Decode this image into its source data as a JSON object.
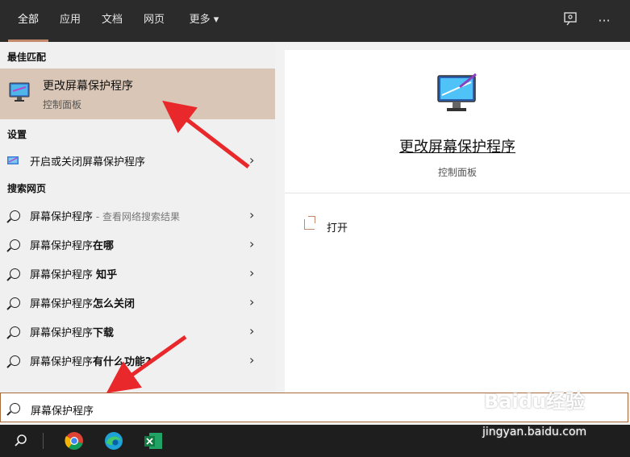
{
  "tabs": [
    "全部",
    "应用",
    "文档",
    "网页",
    "更多 ▾"
  ],
  "topbar_icons": [
    "feedback-icon",
    "more-options-icon"
  ],
  "left": {
    "best_match_heading": "最佳匹配",
    "best_match": {
      "title": "更改屏幕保护程序",
      "subtitle": "控制面板",
      "icon": "monitor-icon"
    },
    "settings_heading": "设置",
    "settings_item": "开启或关闭屏幕保护程序",
    "web_heading": "搜索网页",
    "web_items": [
      {
        "label": "屏幕保护程序",
        "hint": " - 查看网络搜索结果"
      },
      {
        "label": "屏幕保护程序",
        "bold": "在哪"
      },
      {
        "label": "屏幕保护程序 ",
        "bold": "知乎"
      },
      {
        "label": "屏幕保护程序",
        "bold": "怎么关闭"
      },
      {
        "label": "屏幕保护程序",
        "bold": "下载"
      },
      {
        "label": "屏幕保护程序",
        "bold": "有什么功能?"
      }
    ]
  },
  "right": {
    "title": "更改屏幕保护程序",
    "subtitle": "控制面板",
    "open_label": "打开"
  },
  "search": {
    "value": "屏幕保护程序"
  },
  "taskbar_apps": [
    "search-icon",
    "chrome-icon",
    "edge-icon",
    "excel-icon"
  ],
  "watermark": {
    "logo": "Baidu经验",
    "site": "jingyan.baidu.com"
  },
  "colors": {
    "accent": "#c28a6a",
    "highlight": "#d9c6b6",
    "arrow": "#e8282b"
  }
}
